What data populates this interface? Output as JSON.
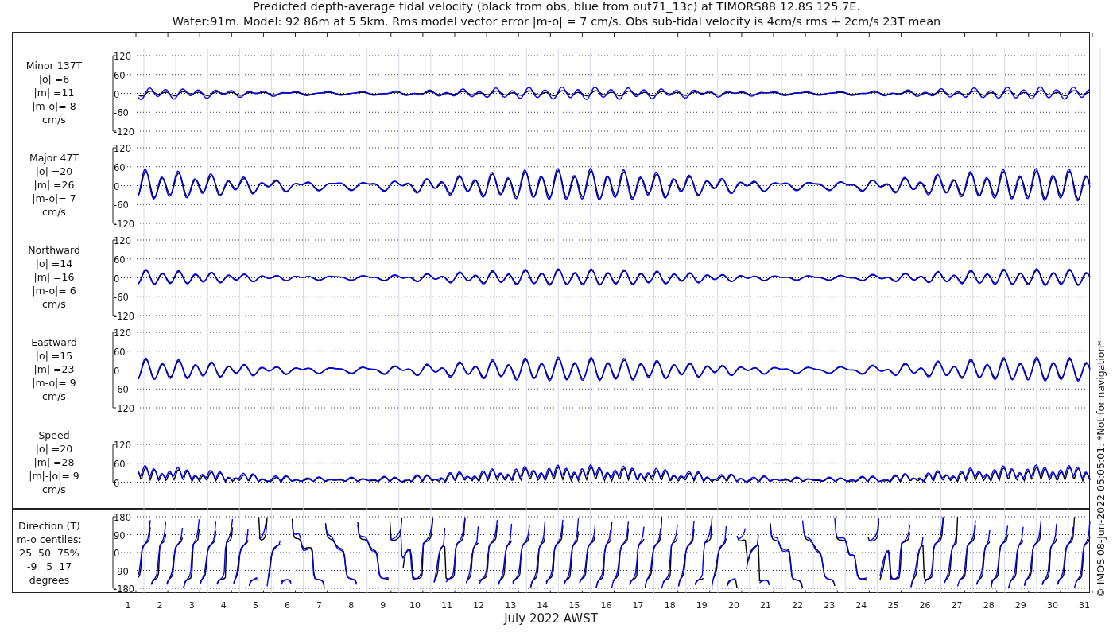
{
  "title": [
    "Predicted depth-average tidal velocity (black from obs, blue from out71_13c) at TIMORS88 12.8S 125.7E.",
    "Water:91m. Model: 92 86m at 5 5km. Rms model vector error |m-o| = 7 cm/s. Obs sub-tidal velocity is 4cm/s rms + 2cm/s 23T mean"
  ],
  "panels": [
    {
      "kind": "minor",
      "label": [
        "Minor 137T",
        "|o| =6",
        "|m| =11",
        "|m-o|= 8",
        "cm/s"
      ],
      "yticks": [
        "120",
        "60",
        "0",
        "-60",
        "-120"
      ]
    },
    {
      "kind": "major",
      "label": [
        "Major 47T",
        "|o| =20",
        "|m| =26",
        "|m-o|= 7",
        "cm/s"
      ],
      "yticks": [
        "120",
        "60",
        "0",
        "-60",
        "-120"
      ]
    },
    {
      "kind": "north",
      "label": [
        "Northward",
        "|o| =14",
        "|m| =16",
        "|m-o|= 6",
        "cm/s"
      ],
      "yticks": [
        "120",
        "60",
        "0",
        "-60",
        "-120"
      ]
    },
    {
      "kind": "east",
      "label": [
        "Eastward",
        "|o| =15",
        "|m| =23",
        "|m-o|= 9",
        "cm/s"
      ],
      "yticks": [
        "120",
        "60",
        "0",
        "-60",
        "-120"
      ]
    },
    {
      "kind": "speed",
      "label": [
        "Speed",
        "|o| =20",
        "|m| =28",
        "|m|-|o|= 9",
        "cm/s"
      ],
      "yticks": [
        "120",
        "60",
        "0"
      ]
    },
    {
      "kind": "direction",
      "label": [
        "Direction (T)",
        "m-o centiles:",
        "25  50  75%",
        "-9   5  17",
        "degrees"
      ],
      "yticks": [
        "180",
        "90",
        "0",
        "-90",
        "-180"
      ]
    }
  ],
  "xticks": [
    "1",
    "2",
    "3",
    "4",
    "5",
    "6",
    "7",
    "8",
    "9",
    "10",
    "11",
    "12",
    "13",
    "14",
    "15",
    "16",
    "17",
    "18",
    "19",
    "20",
    "21",
    "22",
    "23",
    "24",
    "25",
    "26",
    "27",
    "28",
    "29",
    "30",
    "31"
  ],
  "xlabel": "July 2022 AWST",
  "credit": "© IMOS 08-Jun-2022 05:05:01. *Not for navigation*"
}
